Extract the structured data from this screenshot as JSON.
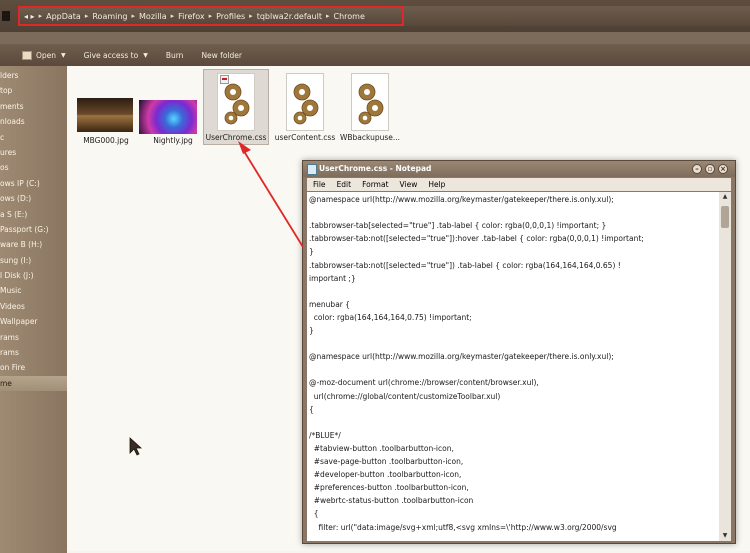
{
  "address": {
    "crumbs": [
      "AppData",
      "Roaming",
      "Mozilla",
      "Firefox",
      "Profiles",
      "tqblwa2r.default",
      "Chrome"
    ]
  },
  "toolbar": {
    "open": "Open",
    "give_access": "Give access to",
    "burn": "Burn",
    "new_folder": "New folder"
  },
  "nav": {
    "items": [
      "lders",
      "top",
      "ments",
      "nloads",
      "c",
      "ures",
      "os",
      "ows IP (C:)",
      "ows (D:)",
      "a S (E:)",
      "Passport (G:)",
      "ware B (H:)",
      "sung (I:)",
      "l Disk (J:)",
      "Music",
      "Videos",
      "Wallpaper",
      "rams",
      "rams",
      "on Fire",
      "me"
    ]
  },
  "files": [
    {
      "name": "MBG000.jpg"
    },
    {
      "name": "Nightly.jpg"
    },
    {
      "name": "UserChrome.css"
    },
    {
      "name": "userContent.css"
    },
    {
      "name": "WBbackupuse..."
    }
  ],
  "notepad": {
    "title": "UserChrome.css - Notepad",
    "menu": [
      "File",
      "Edit",
      "Format",
      "View",
      "Help"
    ],
    "lines": [
      "@namespace url(http://www.mozilla.org/keymaster/gatekeeper/there.is.only.xul);",
      "",
      ".tabbrowser-tab[selected=\"true\"] .tab-label { color: rgba(0,0,0,1) !important; }",
      ".tabbrowser-tab:not([selected=\"true\"]):hover .tab-label { color: rgba(0,0,0,1) !important;",
      "}",
      ".tabbrowser-tab:not([selected=\"true\"]) .tab-label { color: rgba(164,164,164,0.65) !",
      "important ;}",
      "",
      "menubar {",
      "  color: rgba(164,164,164,0.75) !important;",
      "}",
      "",
      "@namespace url(http://www.mozilla.org/keymaster/gatekeeper/there.is.only.xul);",
      "",
      "@-moz-document url(chrome://browser/content/browser.xul),",
      "  url(chrome://global/content/customizeToolbar.xul)",
      "{",
      "",
      "/*BLUE*/",
      "  #tabview-button .toolbarbutton-icon,",
      "  #save-page-button .toolbarbutton-icon,",
      "  #developer-button .toolbarbutton-icon,",
      "  #preferences-button .toolbarbutton-icon,",
      "  #webrtc-status-button .toolbarbutton-icon",
      "  {",
      "    filter: url(\"data:image/svg+xml;utf8,<svg xmlns=\\'http://www.w3.org/2000/svg"
    ]
  },
  "colors": {
    "highlight_border": "#e02828",
    "arrow": "#e02828"
  }
}
